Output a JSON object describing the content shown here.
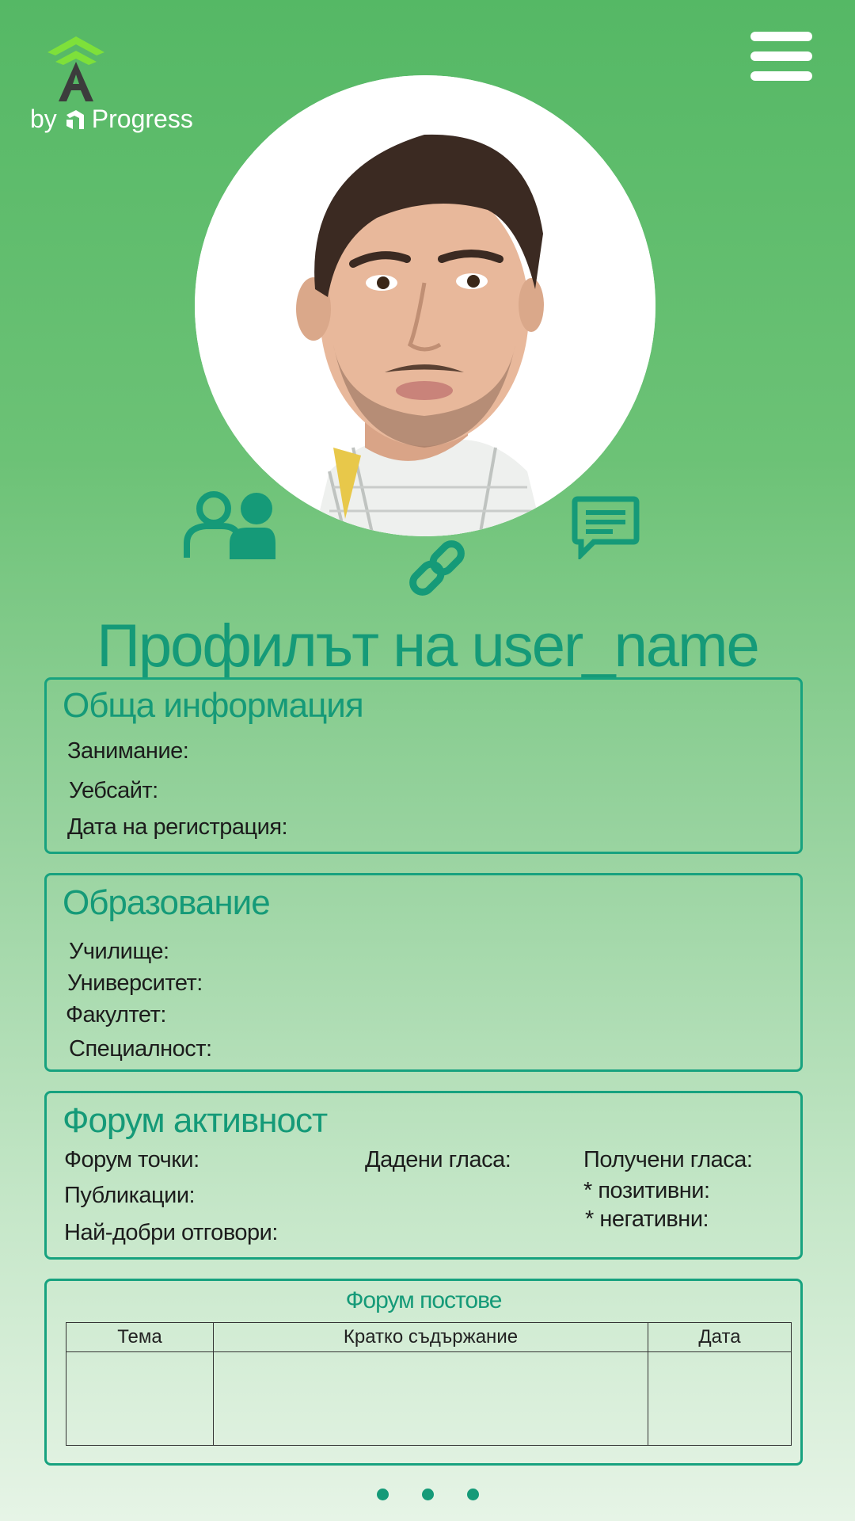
{
  "header": {
    "logo_by": "by",
    "logo_brand": "Progress",
    "menu_icon": "hamburger-menu-icon"
  },
  "profile": {
    "title": "Профилът на user_name",
    "actions": [
      {
        "icon": "people-icon"
      },
      {
        "icon": "link-icon"
      },
      {
        "icon": "message-icon"
      }
    ]
  },
  "general": {
    "heading": "Обща информация",
    "occupation": "Занимание:",
    "website": "Уебсайт:",
    "registered": "Дата на регистрация:"
  },
  "education": {
    "heading": "Образование",
    "school": "Училище:",
    "university": "Университет:",
    "faculty": "Факултет:",
    "specialty": "Специалност:"
  },
  "forum": {
    "heading": "Форум активност",
    "points": "Форум точки:",
    "publications": "Публикации:",
    "best_answers": "Най-добри отговори:",
    "given_votes": "Дадени гласа:",
    "received_votes": "Получени гласа:",
    "positive": "* позитивни:",
    "negative": "* негативни:"
  },
  "posts": {
    "heading": "Форум постове",
    "columns": [
      "Тема",
      "Кратко съдържание",
      "Дата"
    ]
  },
  "colors": {
    "accent": "#159a78",
    "background_top": "#55b865",
    "background_bottom": "#e6f4e6"
  },
  "pagination": {
    "pages": 3
  }
}
